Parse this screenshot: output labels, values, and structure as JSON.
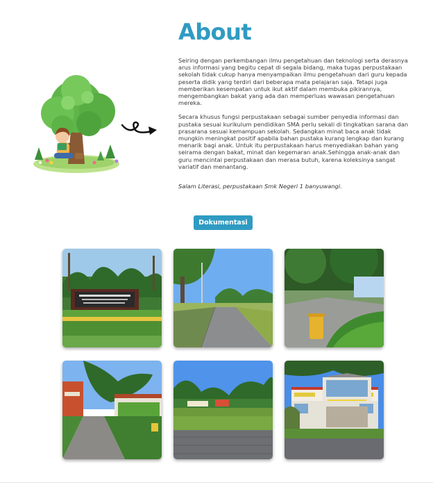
{
  "about": {
    "title": "About",
    "paragraph_1": "Seiring dengan perkembangan ilmu pengetahuan dan teknologi serta derasnya arus informasi yang begitu cepat di segala bidang, maka tugas perpustakaan sekolah tidak cukup hanya menyampaikan ilmu pengetahuan dari guru kepada peserta didik yang terdiri dari beberapa mata pelajaran saja. Tetapi juga memberikan kesempatan untuk ikut aktif dalam membuka pikirannya, mengembangkan bakat yang ada dan memperluas wawasan pengetahuan mereka.",
    "paragraph_2": "Secara khusus fungsi perpustakaan sebagai sumber penyedia informasi dan pustaka sesuai kurikulum pendidikan SMA perlu sekali di tingkatkan sarana dan prasarana sesuai kemampuan sekolah. Sedangkan minat baca anak tidak mungkin meningkat positif apabila bahan pustaka kurang lengkap dan kurang menarik bagi anak. Untuk itu perpustakaan harus menyediakan bahan yang seirama dengan bakat, minat dan kegemaran anak.Sehingga anak-anak dan guru mencintai perpustakaan dan merasa butuh, karena koleksinya sangat variatif dan menantang.",
    "signoff": "Salam Literasi, perpustakaan Smk Negeri 1 banyuwangi."
  },
  "documentation_button": "Dokumentasi",
  "icons": {
    "hero": "child-reading-under-tree-illustration",
    "arrow": "curly-arrow-right-icon"
  },
  "colors": {
    "accent": "#2f9bc2",
    "text": "#3b3b3b"
  },
  "gallery": [
    {
      "name": "school-sign-photo"
    },
    {
      "name": "walkway-trees-photo"
    },
    {
      "name": "garden-bin-photo"
    },
    {
      "name": "building-path-photo"
    },
    {
      "name": "field-trees-photo"
    },
    {
      "name": "school-building-photo"
    }
  ]
}
